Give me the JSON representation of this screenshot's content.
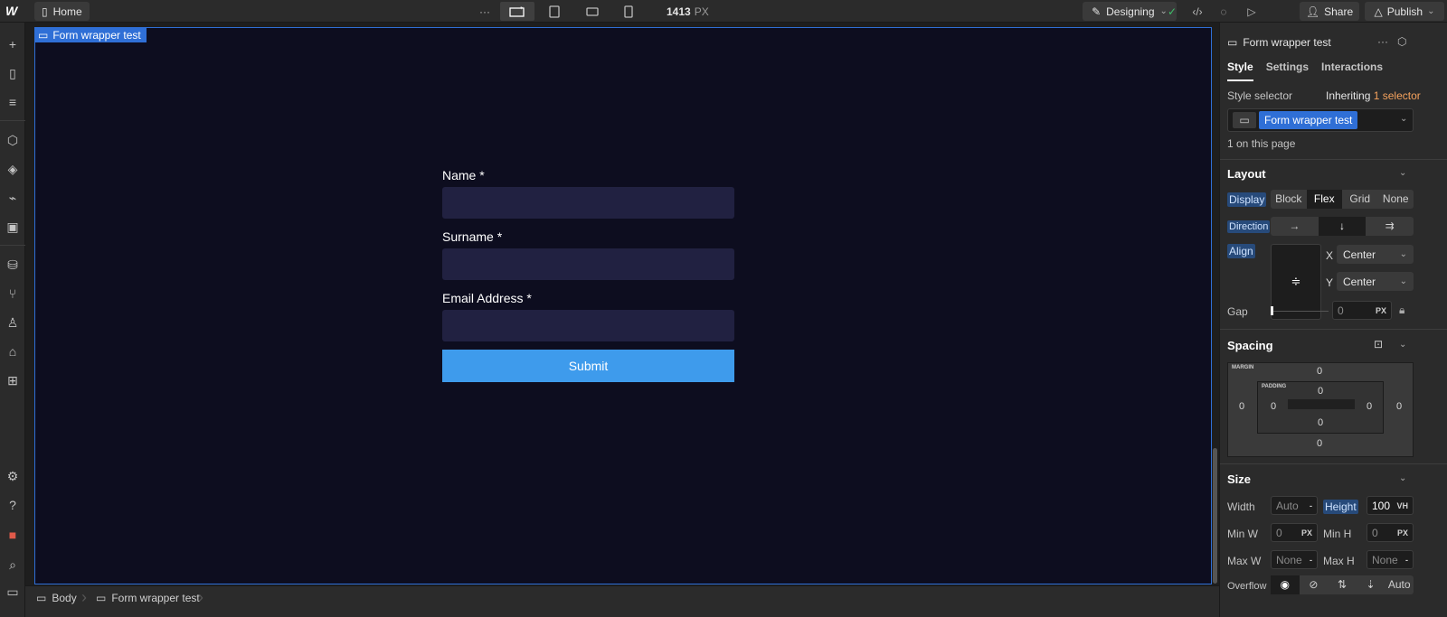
{
  "topbar": {
    "logo": "W",
    "page_name": "Home",
    "more": "···",
    "width_value": "1413",
    "width_unit": "PX",
    "mode_label": "Designing",
    "share_label": "Share",
    "publish_label": "Publish"
  },
  "canvas": {
    "element_tag": "Form wrapper test",
    "form": {
      "fields": [
        {
          "label": "Name *"
        },
        {
          "label": "Surname *"
        },
        {
          "label": "Email Address *"
        }
      ],
      "submit_label": "Submit"
    }
  },
  "breadcrumb": {
    "items": [
      "Body",
      "Form wrapper test"
    ]
  },
  "panel": {
    "title": "Form wrapper test",
    "tabs": [
      "Style",
      "Settings",
      "Interactions"
    ],
    "active_tab": "Style",
    "style_selector_label": "Style selector",
    "inheriting": "Inheriting",
    "selector_count": "1 selector",
    "selector_chip": "Form wrapper test",
    "on_page": "1 on this page",
    "layout": {
      "title": "Layout",
      "display_label": "Display",
      "display_options": [
        "Block",
        "Flex",
        "Grid",
        "None"
      ],
      "display_active": "Flex",
      "direction_label": "Direction",
      "align_label": "Align",
      "x_label": "X",
      "x_value": "Center",
      "y_label": "Y",
      "y_value": "Center",
      "gap_label": "Gap",
      "gap_value": "0",
      "gap_unit": "PX"
    },
    "spacing": {
      "title": "Spacing",
      "margin_label": "MARGIN",
      "padding_label": "PADDING",
      "margin_top": "0",
      "margin_right": "0",
      "margin_bottom": "0",
      "margin_left": "0",
      "padding_top": "0",
      "padding_right": "0",
      "padding_bottom": "0",
      "padding_left": "0"
    },
    "size": {
      "title": "Size",
      "width_label": "Width",
      "width_value": "Auto",
      "width_unit": "-",
      "height_label": "Height",
      "height_value": "100",
      "height_unit": "VH",
      "minw_label": "Min W",
      "minw_value": "0",
      "minw_unit": "PX",
      "minh_label": "Min H",
      "minh_value": "0",
      "minh_unit": "PX",
      "maxw_label": "Max W",
      "maxw_value": "None",
      "maxw_unit": "-",
      "maxh_label": "Max H",
      "maxh_value": "None",
      "maxh_unit": "-",
      "overflow_label": "Overflow",
      "overflow_auto": "Auto"
    }
  },
  "colors": {
    "canvas_bg": "#0d0d1f",
    "input_bg": "#212141",
    "submit_bg": "#3e9bec",
    "selection_blue": "#2f6fd6",
    "accent_orange": "#f5a25d"
  }
}
